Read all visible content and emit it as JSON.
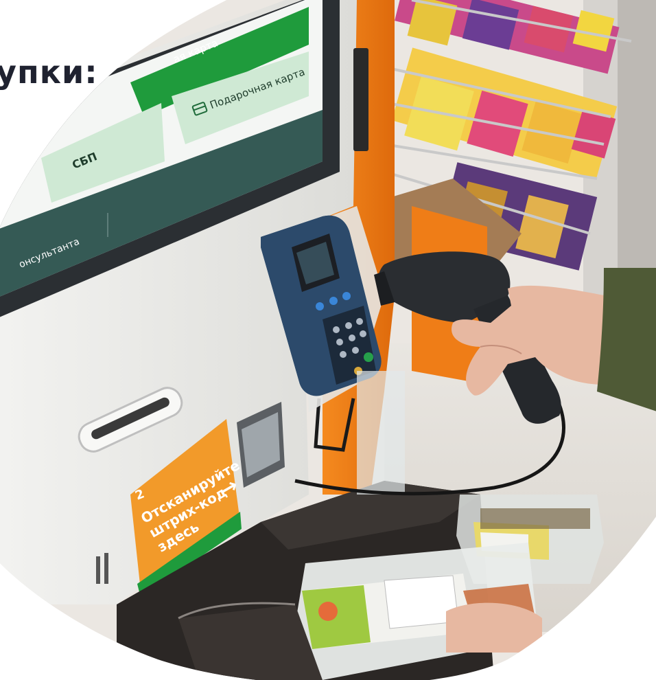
{
  "heading": "упки:",
  "kiosk": {
    "pay_card_label": "ая карта",
    "gift_card_label": "Подарочная карта",
    "sbp_label": "СБП",
    "consultant_label": "онсультанта"
  },
  "sticker": {
    "step_number": "2",
    "line1": "Отсканируйте",
    "line2": "штрих-код",
    "line3": "здесь",
    "arrow": "→"
  },
  "colors": {
    "screen_green": "#1f9b3c",
    "screen_mint": "#cfe9d4",
    "screen_dark": "#355a55",
    "kiosk_orange": "#f07a14",
    "sticker_orange": "#f29a2a"
  }
}
